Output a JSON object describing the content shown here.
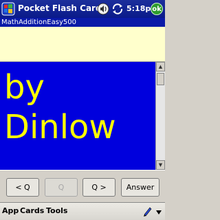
{
  "titlebar": {
    "title": "Pocket Flash Cards",
    "time": "5:18p",
    "ok_label": "ok",
    "icons": [
      "windows-logo-icon",
      "speaker-icon",
      "sync-icon"
    ]
  },
  "deck": {
    "name": "MathAdditionEasy500"
  },
  "question": {
    "text": ""
  },
  "card": {
    "line1": "by",
    "line2": "Dinlow",
    "background": "#0000dd",
    "text_color": "#ffff00"
  },
  "buttons": {
    "prev": "< Q",
    "q": "Q",
    "next": "Q >",
    "answer": "Answer"
  },
  "menu": {
    "items": [
      "App",
      "Cards",
      "Tools"
    ]
  },
  "colors": {
    "titlebar": "#0a1a8a",
    "question_bg": "#ffffcc",
    "deckbar": "#0a1aa8"
  }
}
